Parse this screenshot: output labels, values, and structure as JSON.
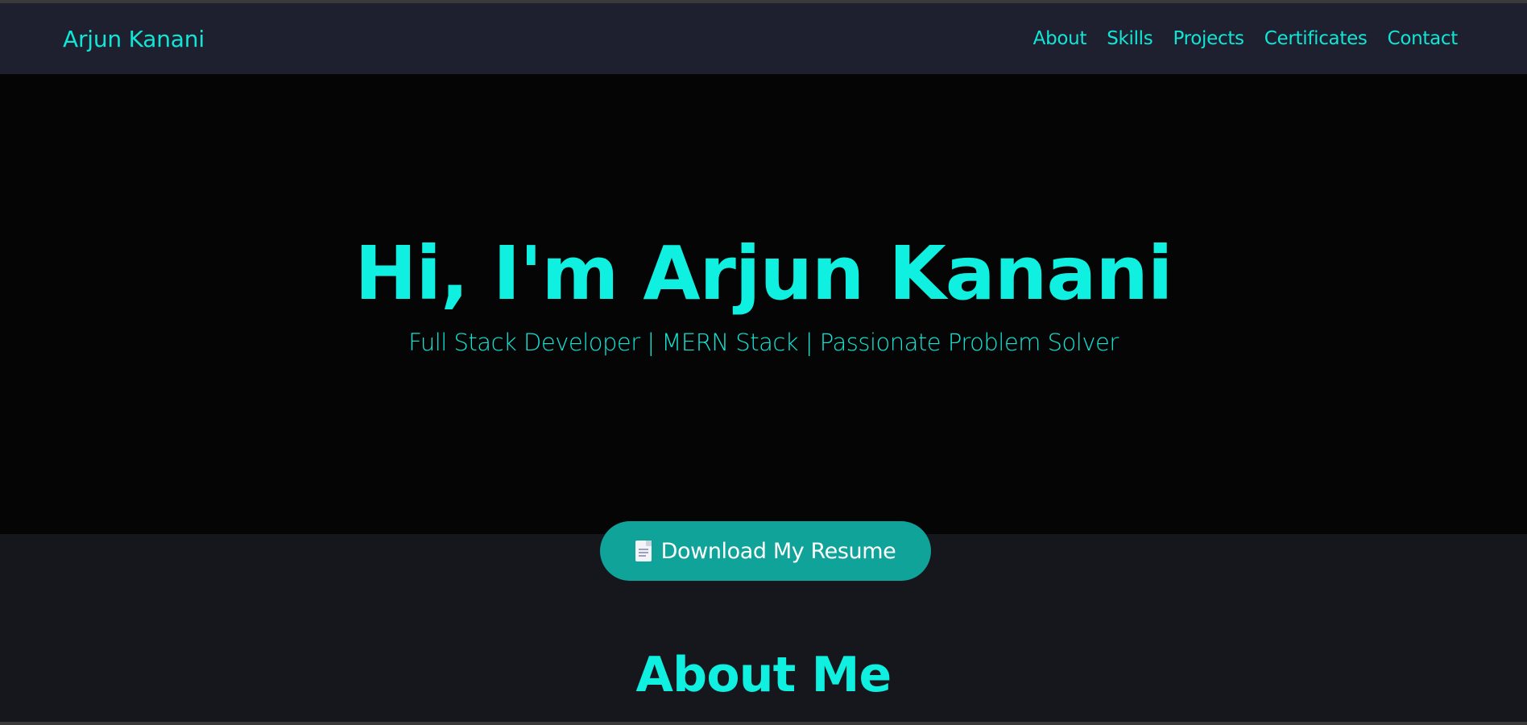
{
  "navbar": {
    "brand": "Arjun Kanani",
    "links": [
      {
        "label": "About"
      },
      {
        "label": "Skills"
      },
      {
        "label": "Projects"
      },
      {
        "label": "Certificates"
      },
      {
        "label": "Contact"
      }
    ]
  },
  "hero": {
    "title": "Hi, I'm Arjun Kanani",
    "subtitle": "Full Stack Developer | MERN Stack | Passionate Problem Solver"
  },
  "resume_button": {
    "icon": "document-icon",
    "label": "Download My Resume"
  },
  "about": {
    "heading": "About Me"
  },
  "colors": {
    "accent": "#11e5d5",
    "button": "#0fa39a",
    "navbar_bg": "#1e2030",
    "hero_bg": "#050505",
    "page_bg": "#16171d"
  }
}
